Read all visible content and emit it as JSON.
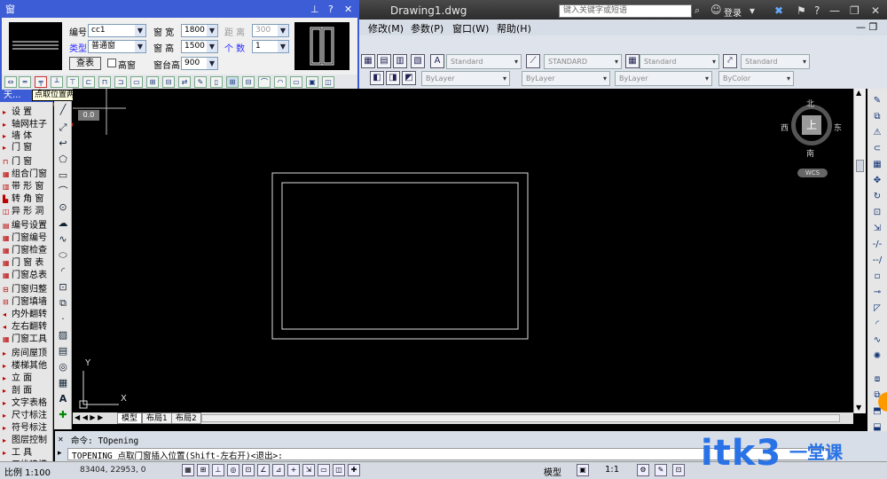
{
  "app": {
    "title": "Drawing1.dwg",
    "search_placeholder": "键入关键字或短语",
    "login_label": "登录"
  },
  "menu": {
    "items": [
      "修改(M)",
      "参数(P)",
      "窗口(W)",
      "帮助(H)"
    ]
  },
  "toolbar": {
    "style_combos": [
      "Standard",
      "STANDARD",
      "Standard",
      "Standard"
    ],
    "layer_combos": [
      "ByLayer",
      "ByLayer",
      "ByLayer",
      "ByColor"
    ]
  },
  "dialog": {
    "title": "窗",
    "fields": {
      "number_label": "编号",
      "number_value": "cc1",
      "type_label": "类型",
      "type_value": "普通窗",
      "width_label": "窗  宽",
      "width_value": "1800",
      "height_label": "窗  高",
      "height_value": "1500",
      "sill_label": "窗台高",
      "sill_value": "900",
      "distance_label": "距  离",
      "distance_value": "300",
      "count_label": "个  数",
      "count_value": "1"
    },
    "lookup_button": "查表",
    "high_window_label": "高窗"
  },
  "tooltip": "点取位置两侧的轴线进行等分插入",
  "left_panel": {
    "header": "天...",
    "items": [
      "设  置",
      "轴网柱子",
      "墙  体",
      "门  窗",
      "门  窗",
      "组合门窗",
      "带 形 窗",
      "转 角 窗",
      "异 形 洞",
      "编号设置",
      "门窗编号",
      "门窗检查",
      "门 窗 表",
      "门窗总表",
      "门窗归整",
      "门窗填墙",
      "内外翻转",
      "左右翻转",
      "门窗工具",
      "房间屋顶",
      "楼梯其他",
      "立  面",
      "剖  面",
      "文字表格",
      "尺寸标注",
      "符号标注",
      "图层控制",
      "工  具",
      "三维建模"
    ]
  },
  "viewcube": {
    "north": "北",
    "south": "南",
    "east": "东",
    "west": "西",
    "top": "上",
    "wcs": "WCS"
  },
  "canvas": {
    "coord_tooltip": "0.0",
    "axis_y": "Y",
    "axis_x": "X"
  },
  "layout_tabs": [
    "模型",
    "布局1",
    "布局2"
  ],
  "command": {
    "line1": "命令: TOpening",
    "line2": "TOPENING 点取门窗插入位置(Shift-左右开)<退出>:"
  },
  "status": {
    "scale": "比例 1:100",
    "coordinates": "83404, 22953, 0",
    "model_label": "模型",
    "annotation_scale": "1:1"
  },
  "watermark": {
    "text": "itk3",
    "suffix": "一堂课"
  },
  "colors": {
    "dialog_border": "#3d5dd6",
    "watermark": "#2a73e6"
  }
}
